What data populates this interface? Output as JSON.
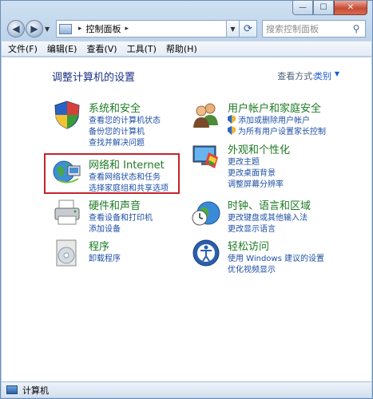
{
  "window": {
    "caption_buttons": {
      "minimize": "—",
      "maximize": "☐",
      "close": "✕"
    }
  },
  "nav": {
    "back_icon": "◀",
    "forward_icon": "▶",
    "breadcrumb": "控制面板",
    "breadcrumb_sep": "▸",
    "refresh_icon": "⟳",
    "search_placeholder": "搜索控制面板",
    "search_icon": "⚲"
  },
  "menu": [
    "文件(F)",
    "编辑(E)",
    "查看(V)",
    "工具(T)",
    "帮助(H)"
  ],
  "main": {
    "title": "调整计算机的设置",
    "view_by_label": "查看方式:",
    "view_by_value": "类别",
    "categories": [
      {
        "title": "系统和安全",
        "links": [
          "查看您的计算机状态",
          "备份您的计算机",
          "查找并解决问题"
        ],
        "icon": "shield-icon"
      },
      {
        "title": "网络和 Internet",
        "links": [
          "查看网络状态和任务",
          "选择家庭组和共享选项"
        ],
        "icon": "network-globe-icon"
      },
      {
        "title": "硬件和声音",
        "links": [
          "查看设备和打印机",
          "添加设备"
        ],
        "icon": "printer-icon"
      },
      {
        "title": "程序",
        "links": [
          "卸载程序"
        ],
        "icon": "program-disc-icon"
      },
      {
        "title": "用户帐户和家庭安全",
        "links": [
          "添加或删除用户帐户",
          "为所有用户设置家长控制"
        ],
        "icon": "users-icon"
      },
      {
        "title": "外观和个性化",
        "links": [
          "更改主题",
          "更改桌面背景",
          "调整屏幕分辨率"
        ],
        "icon": "monitor-palette-icon"
      },
      {
        "title": "时钟、语言和区域",
        "links": [
          "更改键盘或其他输入法",
          "更改显示语言"
        ],
        "icon": "clock-globe-icon"
      },
      {
        "title": "轻松访问",
        "links": [
          "使用 Windows 建议的设置",
          "优化视频显示"
        ],
        "icon": "ease-of-access-icon"
      }
    ]
  },
  "status": {
    "text": "计算机"
  }
}
